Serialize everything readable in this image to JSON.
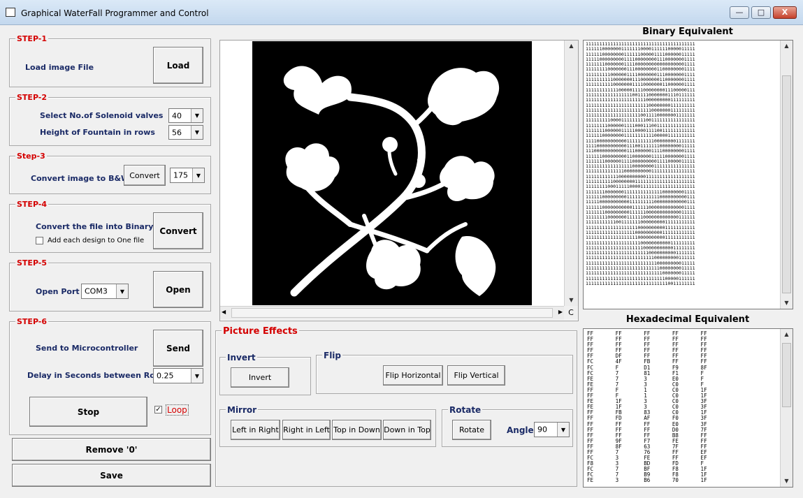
{
  "window": {
    "title": "Graphical WaterFall Programmer and Control",
    "minimize": "—",
    "maximize": "□",
    "close": "X"
  },
  "step1": {
    "heading": "STEP-1",
    "label": "Load image File",
    "button": "Load"
  },
  "step2": {
    "heading": "STEP-2",
    "solenoid_label": "Select No.of Solenoid valves",
    "solenoid_value": "40",
    "height_label": "Height of Fountain in rows",
    "height_value": "56"
  },
  "step3": {
    "heading": "Step-3",
    "label": "Convert image to B&W",
    "button": "Convert",
    "threshold_value": "175"
  },
  "step4": {
    "heading": "STEP-4",
    "label": "Convert the file into Binary",
    "checkbox_label": "Add each design to One file",
    "checkbox_checked": false,
    "button": "Convert"
  },
  "step5": {
    "heading": "STEP-5",
    "label": "Open Port",
    "port_value": "COM3",
    "button": "Open"
  },
  "step6": {
    "heading": "STEP-6",
    "send_label": "Send to Microcontroller",
    "send_button": "Send",
    "delay_label": "Delay in Seconds between Rows",
    "delay_value": "0.25",
    "stop_button": "Stop",
    "loop_label": "Loop",
    "loop_checked": "✓"
  },
  "bottom": {
    "remove_button": "Remove '0'",
    "save_button": "Save"
  },
  "preview": {
    "clear_button": "C"
  },
  "effects": {
    "heading": "Picture Effects",
    "invert_group": "Invert",
    "invert_button": "Invert",
    "flip_group": "Flip",
    "flip_h_button": "Flip Horizontal",
    "flip_v_button": "Flip Vertical",
    "mirror_group": "Mirror",
    "left_in_right": "Left in Right",
    "right_in_left": "Right in Left",
    "top_in_down": "Top in Down",
    "down_in_top": "Down in Top",
    "rotate_group": "Rotate",
    "rotate_button": "Rotate",
    "angle_label": "Angle",
    "angle_value": "90"
  },
  "binary": {
    "title": "Binary Equivalent",
    "text": "1111111111111111111111111111111111111111\n1111110000000111111100001111110000011111\n1111110000000011111100000111100000011111\n1111100000000011110000000011100000001111\n1111111000000011110000000000000000001111\n1111111100000001110000000011000000001111\n1111111110000001111000000011100000001111\n1111111111000000011100000001100000001111\n1111111111000000011110000000110000001111\n1111111111110000011110000000011100000111\n1111111111111111100111100000001110111111\n1111111111111111111111000000000111111111\n1111111111111111111111100000000111111111\n1111111111111111111111110000000111111111\n1111111111111111111100111100000001111111\n1111111110000111111111001111111111111111\n1111111100000011110001110011111111111111\n1111111000000111110000111100111111111111\n1111110000000011111111111000001111111111\n1111000000000001111111111000000001111111\n1111000000000001110011111110000000011111\n1110000000000001110000001111000000001111\n1111110000000001100000001111100000001111\n1111111000000111100000000011110000011111\n1111111111111111100000000111111111111111\n1111111111111100000000001111111111111111\n1111111111110000000000111111111111111111\n1111111111000000001111111111111111111111\n1111111100011111000011111111111111111111\n1111111000000011111111111111000000001111\n1111110000000001111111111110000000000111\n1111100000000000111111111000000000000111\n1111110000000000011111100000000000001111\n1111111000000000111111000000000000011111\n1111111100000001111110000000000000111111\n1111111111100111111100000000011111111111\n1111111111111111111000000000011111111111\n1111111111111111110000000000111111111111\n1111111111111111111000000000011111111111\n1111111111111111111100000000000111111111\n1111111111111111111110000000000011111111\n1111111111111111111111100000000001111111\n1111111111111111111111111000000000111111\n1111111111111111111111111100000000011111\n1111111111111111111111111110000000011111\n1111111111111111111111111111000000011111\n1111111111111111111111111111100000111111\n1111111111111111111111111111110011111111"
  },
  "hex": {
    "title": "Hexadecimal Equivalent",
    "text": "FF       FF       FF       FF       FF\nFF       FF       FF       FF       FF\nFF       FF       FF       FF       FF\nFF       FF       FF       FF       FF\nFF       DF       FF       FF       FF\nFC       4F       FB       FF       FF\nFC       F        D1       F9       8F\nFC       7        81       F1       F\nFE       7        3        E0       F\nFE       7        3        C0       F\nFF       F        1        C0       1F\nFF       F        1        C0       1F\nFE       1F       3        C0       3F\nFE       1F       3        C0       3F\nFF       FB       83       C0       1F\nFF       FD       AF       F0       3F\nFF       FF       FF       E0       3F\nFF       FF       FF       D0       7F\nFF       FF       FF       B8       FF\nFF       9F       F7       FE       FF\nFF       8F       63       7F       FF\nFF       7        76       FF       EF\nFC       3        FE       FF       EF\nF8       3        BD       FD       F\nFC       7        BF       F8       1F\nFC       7        B9       F8       1F\nFE       3        B6       70       1F"
  },
  "colors": {
    "accent_red": "#d40000",
    "label_navy": "#1a2a66"
  },
  "icons": [
    "app-icon",
    "minimize-icon",
    "maximize-icon",
    "close-icon",
    "dropdown-arrow-icon",
    "scroll-up-icon",
    "scroll-down-icon",
    "scroll-left-icon",
    "scroll-right-icon"
  ]
}
